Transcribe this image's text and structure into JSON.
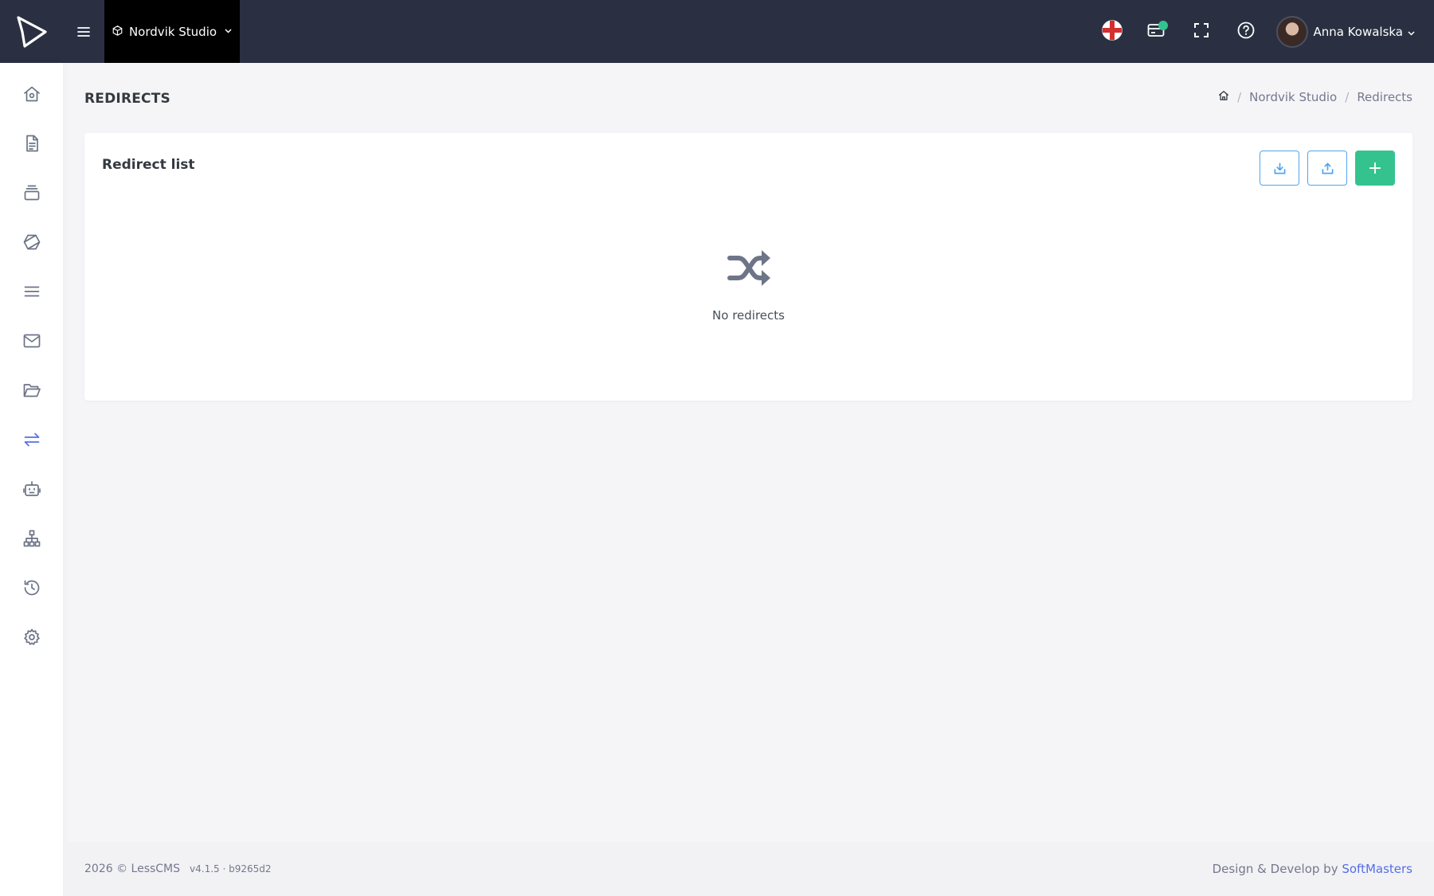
{
  "header": {
    "project_name": "Nordvik Studio",
    "user_name": "Anna Kowalska",
    "icons": [
      "logo-play-icon",
      "hamburger-icon",
      "box-icon",
      "uk-flag-icon",
      "billing-card-icon",
      "fullscreen-icon",
      "help-icon"
    ],
    "notification_color": "#34c38f"
  },
  "sidebar": {
    "items": [
      {
        "name": "home",
        "icon": "home-icon"
      },
      {
        "name": "pages",
        "icon": "document-icon"
      },
      {
        "name": "collections",
        "icon": "layers-icon"
      },
      {
        "name": "components",
        "icon": "hexagon-icon"
      },
      {
        "name": "menus",
        "icon": "list-icon"
      },
      {
        "name": "mail",
        "icon": "mail-icon"
      },
      {
        "name": "files",
        "icon": "folder-icon"
      },
      {
        "name": "redirects",
        "icon": "arrows-exchange-icon",
        "active": true
      },
      {
        "name": "robots",
        "icon": "robot-icon"
      },
      {
        "name": "sitemap",
        "icon": "sitemap-icon"
      },
      {
        "name": "history",
        "icon": "history-icon"
      },
      {
        "name": "settings",
        "icon": "gear-icon"
      }
    ],
    "active_color": "#556ee6"
  },
  "page": {
    "title": "REDIRECTS",
    "breadcrumb": {
      "project": "Nordvik Studio",
      "separator": "/",
      "current": "Redirects"
    }
  },
  "card": {
    "title": "Redirect list",
    "add_label": "+",
    "empty_text": "No redirects"
  },
  "footer": {
    "copyright": "2026 © LessCMS",
    "version": "v4.1.5 · b9265d2",
    "credit_prefix": "Design & Develop by",
    "credit_link": "SoftMasters"
  },
  "colors": {
    "topbar": "#2a3042",
    "accent": "#556ee6",
    "success": "#34c38f",
    "info": "#50a5f1"
  }
}
